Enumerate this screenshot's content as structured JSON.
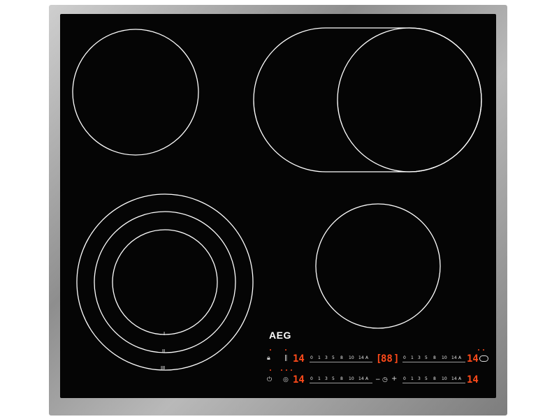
{
  "brand": "AEG",
  "zone_marks": [
    "I",
    "II",
    "III"
  ],
  "controls": {
    "row1": {
      "left_display": "14",
      "middle_display": "88",
      "right_display": "14",
      "scale_left": [
        "0",
        "1",
        "3",
        "5",
        "8",
        "10",
        "14",
        "A"
      ],
      "scale_right": [
        "0",
        "1",
        "3",
        "5",
        "8",
        "10",
        "14",
        "A"
      ]
    },
    "row2": {
      "left_display": "14",
      "right_display": "14",
      "scale_left": [
        "0",
        "1",
        "3",
        "5",
        "8",
        "10",
        "14",
        "A"
      ],
      "scale_right": [
        "0",
        "1",
        "3",
        "5",
        "8",
        "10",
        "14",
        "A"
      ]
    }
  },
  "icons": {
    "lock": "lock-icon",
    "pause": "pause-icon",
    "power": "power-icon",
    "bridge": "bridge-zone-icon",
    "timer": "timer-icon",
    "minus": "minus-icon",
    "plus": "plus-icon",
    "oval": "oval-zone-icon"
  },
  "colors": {
    "display": "#ff4a1a",
    "glass": "#050505",
    "burner_line": "#ffffff"
  }
}
